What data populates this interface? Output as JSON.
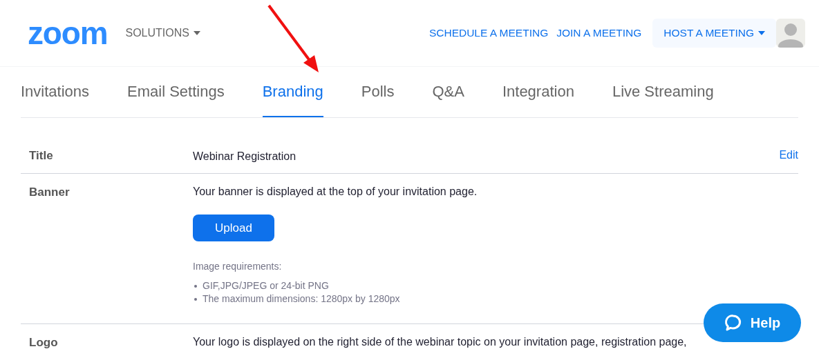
{
  "header": {
    "logo": "zoom",
    "solutions": "SOLUTIONS",
    "links": [
      "SCHEDULE A MEETING",
      "JOIN A MEETING"
    ],
    "host": "HOST A MEETING"
  },
  "tabs": [
    {
      "label": "Invitations",
      "selected": false
    },
    {
      "label": "Email Settings",
      "selected": false
    },
    {
      "label": "Branding",
      "selected": true
    },
    {
      "label": "Polls",
      "selected": false
    },
    {
      "label": "Q&A",
      "selected": false
    },
    {
      "label": "Integration",
      "selected": false
    },
    {
      "label": "Live Streaming",
      "selected": false
    }
  ],
  "rows": [
    {
      "kind": "title",
      "label": "Title",
      "value": "Webinar Registration",
      "action": "Edit"
    },
    {
      "kind": "upload",
      "label": "Banner",
      "description": "Your banner is displayed at the top of your invitation page.",
      "button": "Upload",
      "requirements_title": "Image requirements:",
      "requirements": [
        "GIF,JPG/JPEG or 24-bit PNG",
        "The maximum dimensions: 1280px by 1280px"
      ]
    },
    {
      "kind": "text",
      "label": "Logo",
      "description": "Your logo is displayed on the right side of the webinar topic on your invitation page, registration page,"
    }
  ],
  "help": "Help"
}
